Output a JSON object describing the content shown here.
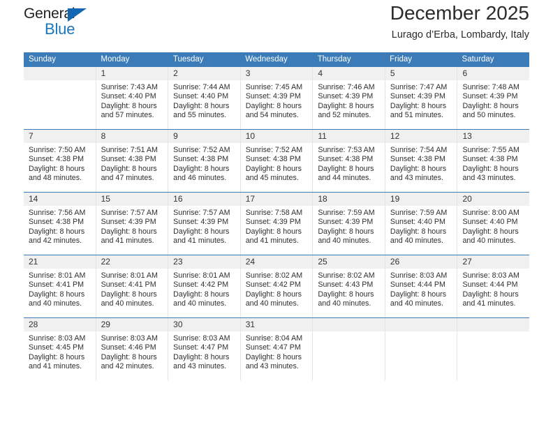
{
  "logo": {
    "word_one": "General",
    "word_two": "Blue",
    "triangle_color": "#1268b3",
    "blue_color": "#1b75bb"
  },
  "header": {
    "month_title": "December 2025",
    "location": "Lurago d’Erba, Lombardy, Italy"
  },
  "theme": {
    "header_blue": "#3b7cb8",
    "daynum_band": "#f0f0f0",
    "grid_line": "#e4e4e4"
  },
  "calendar": {
    "weekdays": [
      "Sunday",
      "Monday",
      "Tuesday",
      "Wednesday",
      "Thursday",
      "Friday",
      "Saturday"
    ],
    "weeks": [
      [
        {
          "day": "",
          "sunrise": "",
          "sunset": "",
          "daylight_line1": "",
          "daylight_line2": ""
        },
        {
          "day": "1",
          "sunrise": "Sunrise: 7:43 AM",
          "sunset": "Sunset: 4:40 PM",
          "daylight_line1": "Daylight: 8 hours",
          "daylight_line2": "and 57 minutes."
        },
        {
          "day": "2",
          "sunrise": "Sunrise: 7:44 AM",
          "sunset": "Sunset: 4:40 PM",
          "daylight_line1": "Daylight: 8 hours",
          "daylight_line2": "and 55 minutes."
        },
        {
          "day": "3",
          "sunrise": "Sunrise: 7:45 AM",
          "sunset": "Sunset: 4:39 PM",
          "daylight_line1": "Daylight: 8 hours",
          "daylight_line2": "and 54 minutes."
        },
        {
          "day": "4",
          "sunrise": "Sunrise: 7:46 AM",
          "sunset": "Sunset: 4:39 PM",
          "daylight_line1": "Daylight: 8 hours",
          "daylight_line2": "and 52 minutes."
        },
        {
          "day": "5",
          "sunrise": "Sunrise: 7:47 AM",
          "sunset": "Sunset: 4:39 PM",
          "daylight_line1": "Daylight: 8 hours",
          "daylight_line2": "and 51 minutes."
        },
        {
          "day": "6",
          "sunrise": "Sunrise: 7:48 AM",
          "sunset": "Sunset: 4:39 PM",
          "daylight_line1": "Daylight: 8 hours",
          "daylight_line2": "and 50 minutes."
        }
      ],
      [
        {
          "day": "7",
          "sunrise": "Sunrise: 7:50 AM",
          "sunset": "Sunset: 4:38 PM",
          "daylight_line1": "Daylight: 8 hours",
          "daylight_line2": "and 48 minutes."
        },
        {
          "day": "8",
          "sunrise": "Sunrise: 7:51 AM",
          "sunset": "Sunset: 4:38 PM",
          "daylight_line1": "Daylight: 8 hours",
          "daylight_line2": "and 47 minutes."
        },
        {
          "day": "9",
          "sunrise": "Sunrise: 7:52 AM",
          "sunset": "Sunset: 4:38 PM",
          "daylight_line1": "Daylight: 8 hours",
          "daylight_line2": "and 46 minutes."
        },
        {
          "day": "10",
          "sunrise": "Sunrise: 7:52 AM",
          "sunset": "Sunset: 4:38 PM",
          "daylight_line1": "Daylight: 8 hours",
          "daylight_line2": "and 45 minutes."
        },
        {
          "day": "11",
          "sunrise": "Sunrise: 7:53 AM",
          "sunset": "Sunset: 4:38 PM",
          "daylight_line1": "Daylight: 8 hours",
          "daylight_line2": "and 44 minutes."
        },
        {
          "day": "12",
          "sunrise": "Sunrise: 7:54 AM",
          "sunset": "Sunset: 4:38 PM",
          "daylight_line1": "Daylight: 8 hours",
          "daylight_line2": "and 43 minutes."
        },
        {
          "day": "13",
          "sunrise": "Sunrise: 7:55 AM",
          "sunset": "Sunset: 4:38 PM",
          "daylight_line1": "Daylight: 8 hours",
          "daylight_line2": "and 43 minutes."
        }
      ],
      [
        {
          "day": "14",
          "sunrise": "Sunrise: 7:56 AM",
          "sunset": "Sunset: 4:38 PM",
          "daylight_line1": "Daylight: 8 hours",
          "daylight_line2": "and 42 minutes."
        },
        {
          "day": "15",
          "sunrise": "Sunrise: 7:57 AM",
          "sunset": "Sunset: 4:39 PM",
          "daylight_line1": "Daylight: 8 hours",
          "daylight_line2": "and 41 minutes."
        },
        {
          "day": "16",
          "sunrise": "Sunrise: 7:57 AM",
          "sunset": "Sunset: 4:39 PM",
          "daylight_line1": "Daylight: 8 hours",
          "daylight_line2": "and 41 minutes."
        },
        {
          "day": "17",
          "sunrise": "Sunrise: 7:58 AM",
          "sunset": "Sunset: 4:39 PM",
          "daylight_line1": "Daylight: 8 hours",
          "daylight_line2": "and 41 minutes."
        },
        {
          "day": "18",
          "sunrise": "Sunrise: 7:59 AM",
          "sunset": "Sunset: 4:39 PM",
          "daylight_line1": "Daylight: 8 hours",
          "daylight_line2": "and 40 minutes."
        },
        {
          "day": "19",
          "sunrise": "Sunrise: 7:59 AM",
          "sunset": "Sunset: 4:40 PM",
          "daylight_line1": "Daylight: 8 hours",
          "daylight_line2": "and 40 minutes."
        },
        {
          "day": "20",
          "sunrise": "Sunrise: 8:00 AM",
          "sunset": "Sunset: 4:40 PM",
          "daylight_line1": "Daylight: 8 hours",
          "daylight_line2": "and 40 minutes."
        }
      ],
      [
        {
          "day": "21",
          "sunrise": "Sunrise: 8:01 AM",
          "sunset": "Sunset: 4:41 PM",
          "daylight_line1": "Daylight: 8 hours",
          "daylight_line2": "and 40 minutes."
        },
        {
          "day": "22",
          "sunrise": "Sunrise: 8:01 AM",
          "sunset": "Sunset: 4:41 PM",
          "daylight_line1": "Daylight: 8 hours",
          "daylight_line2": "and 40 minutes."
        },
        {
          "day": "23",
          "sunrise": "Sunrise: 8:01 AM",
          "sunset": "Sunset: 4:42 PM",
          "daylight_line1": "Daylight: 8 hours",
          "daylight_line2": "and 40 minutes."
        },
        {
          "day": "24",
          "sunrise": "Sunrise: 8:02 AM",
          "sunset": "Sunset: 4:42 PM",
          "daylight_line1": "Daylight: 8 hours",
          "daylight_line2": "and 40 minutes."
        },
        {
          "day": "25",
          "sunrise": "Sunrise: 8:02 AM",
          "sunset": "Sunset: 4:43 PM",
          "daylight_line1": "Daylight: 8 hours",
          "daylight_line2": "and 40 minutes."
        },
        {
          "day": "26",
          "sunrise": "Sunrise: 8:03 AM",
          "sunset": "Sunset: 4:44 PM",
          "daylight_line1": "Daylight: 8 hours",
          "daylight_line2": "and 40 minutes."
        },
        {
          "day": "27",
          "sunrise": "Sunrise: 8:03 AM",
          "sunset": "Sunset: 4:44 PM",
          "daylight_line1": "Daylight: 8 hours",
          "daylight_line2": "and 41 minutes."
        }
      ],
      [
        {
          "day": "28",
          "sunrise": "Sunrise: 8:03 AM",
          "sunset": "Sunset: 4:45 PM",
          "daylight_line1": "Daylight: 8 hours",
          "daylight_line2": "and 41 minutes."
        },
        {
          "day": "29",
          "sunrise": "Sunrise: 8:03 AM",
          "sunset": "Sunset: 4:46 PM",
          "daylight_line1": "Daylight: 8 hours",
          "daylight_line2": "and 42 minutes."
        },
        {
          "day": "30",
          "sunrise": "Sunrise: 8:03 AM",
          "sunset": "Sunset: 4:47 PM",
          "daylight_line1": "Daylight: 8 hours",
          "daylight_line2": "and 43 minutes."
        },
        {
          "day": "31",
          "sunrise": "Sunrise: 8:04 AM",
          "sunset": "Sunset: 4:47 PM",
          "daylight_line1": "Daylight: 8 hours",
          "daylight_line2": "and 43 minutes."
        },
        {
          "day": "",
          "sunrise": "",
          "sunset": "",
          "daylight_line1": "",
          "daylight_line2": ""
        },
        {
          "day": "",
          "sunrise": "",
          "sunset": "",
          "daylight_line1": "",
          "daylight_line2": ""
        },
        {
          "day": "",
          "sunrise": "",
          "sunset": "",
          "daylight_line1": "",
          "daylight_line2": ""
        }
      ]
    ]
  }
}
